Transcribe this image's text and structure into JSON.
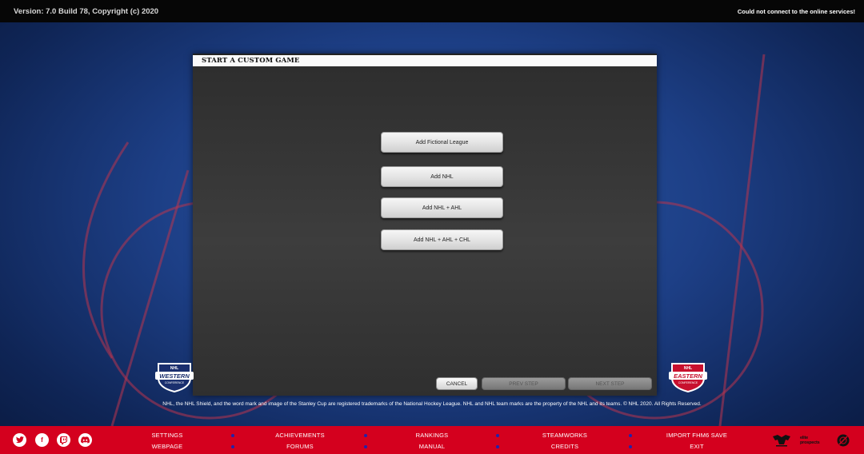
{
  "topbar": {
    "version": "Version: 7.0 Build 78, Copyright (c) 2020",
    "status": "Could not connect to the online services!"
  },
  "dialog": {
    "title": "START A CUSTOM GAME",
    "options": [
      {
        "label": "Add Fictional League"
      },
      {
        "label": "Add NHL"
      },
      {
        "label": "Add NHL + AHL"
      },
      {
        "label": "Add NHL + AHL + CHL"
      }
    ],
    "cancel": "CANCEL",
    "prev": "PREV STEP",
    "next": "NEXT STEP"
  },
  "logos": {
    "western": {
      "line1": "NHL",
      "line2": "WESTERN",
      "line3": "CONFERENCE"
    },
    "eastern": {
      "line1": "NHL",
      "line2": "EASTERN",
      "line3": "CONFERENCE"
    }
  },
  "legal": "NHL, the NHL Shield, and the word mark and image of the Stanley Cup are registered trademarks of the National Hockey League. NHL and NHL team marks are the property of the NHL and its teams. © NHL 2020. All Rights Reserved.",
  "footer": {
    "social_icons": [
      "twitter-icon",
      "facebook-icon",
      "twitch-icon",
      "discord-icon"
    ],
    "nav_row1": [
      "SETTINGS",
      "ACHIEVEMENTS",
      "RANKINGS",
      "STEAMWORKS",
      "IMPORT FHM6 SAVE"
    ],
    "nav_row2": [
      "WEBPAGE",
      "FORUMS",
      "MANUAL",
      "CREDITS",
      "EXIT"
    ],
    "partners": {
      "elite": "elite prospects"
    }
  },
  "colors": {
    "footer": "#d4001e",
    "background": "#1d3f86",
    "dialog": "#333333"
  }
}
